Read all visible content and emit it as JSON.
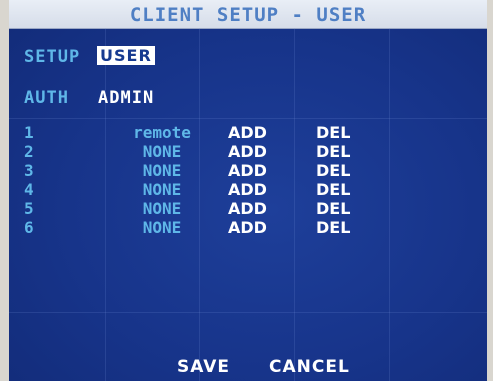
{
  "title": "CLIENT SETUP - USER",
  "setup": {
    "label": "SETUP",
    "value": "USER"
  },
  "auth": {
    "label": "AUTH",
    "value": "ADMIN"
  },
  "users": [
    {
      "num": "1",
      "name": "remote",
      "add": "ADD",
      "del": "DEL"
    },
    {
      "num": "2",
      "name": "NONE",
      "add": "ADD",
      "del": "DEL"
    },
    {
      "num": "3",
      "name": "NONE",
      "add": "ADD",
      "del": "DEL"
    },
    {
      "num": "4",
      "name": "NONE",
      "add": "ADD",
      "del": "DEL"
    },
    {
      "num": "5",
      "name": "NONE",
      "add": "ADD",
      "del": "DEL"
    },
    {
      "num": "6",
      "name": "NONE",
      "add": "ADD",
      "del": "DEL"
    }
  ],
  "buttons": {
    "save": "SAVE",
    "cancel": "CANCEL"
  },
  "colors": {
    "background": "#17348a",
    "label": "#5fb7e8",
    "title": "#4f7fc4",
    "text": "#ffffff"
  }
}
